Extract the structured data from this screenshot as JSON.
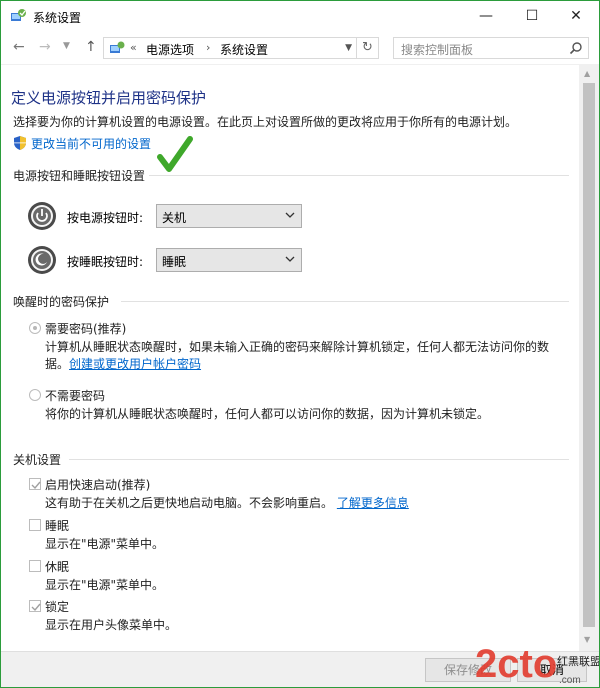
{
  "window": {
    "title": "系统设置",
    "min_glyph": "—",
    "max_glyph": "☐",
    "close_glyph": "✕"
  },
  "nav": {
    "back_glyph": "←",
    "forward_glyph": "→",
    "up_glyph": "↑",
    "breadcrumb_prefix": "«",
    "breadcrumb": [
      "电源选项",
      "系统设置"
    ],
    "breadcrumb_sep": "›",
    "search_placeholder": "搜索控制面板"
  },
  "page": {
    "title": "定义电源按钮并启用密码保护",
    "description": "选择要为你的计算机设置的电源设置。在此页上对设置所做的更改将应用于你所有的电源计划。",
    "change_link": "更改当前不可用的设置"
  },
  "power_buttons": {
    "heading": "电源按钮和睡眠按钮设置",
    "rows": [
      {
        "label": "按电源按钮时:",
        "value": "关机"
      },
      {
        "label": "按睡眠按钮时:",
        "value": "睡眠"
      }
    ]
  },
  "wake_password": {
    "heading": "唤醒时的密码保护",
    "options": [
      {
        "label": "需要密码(推荐)",
        "selected": true,
        "desc_line1": "计算机从睡眠状态唤醒时，如果未输入正确的密码来解除计算机锁定，任何人都无法访问你的数",
        "desc_line2_prefix": "据。",
        "desc_link": "创建或更改用户帐户密码"
      },
      {
        "label": "不需要密码",
        "selected": false,
        "desc_line1": "将你的计算机从睡眠状态唤醒时，任何人都可以访问你的数据，因为计算机未锁定。"
      }
    ]
  },
  "shutdown": {
    "heading": "关机设置",
    "items": [
      {
        "label": "启用快速启动(推荐)",
        "checked": true,
        "desc": "这有助于在关机之后更快地启动电脑。不会影响重启。",
        "link": "了解更多信息"
      },
      {
        "label": "睡眠",
        "checked": false,
        "desc": "显示在\"电源\"菜单中。"
      },
      {
        "label": "休眠",
        "checked": false,
        "desc": "显示在\"电源\"菜单中。"
      },
      {
        "label": "锁定",
        "checked": true,
        "desc": "显示在用户头像菜单中。"
      }
    ]
  },
  "footer": {
    "save_label": "保存修改",
    "cancel_label": "取消"
  },
  "watermark": {
    "brand": "2cto",
    "tag": "红黑联盟",
    "sub": ".com"
  },
  "colors": {
    "title_blue": "#1e3287",
    "link_blue": "#0066cc",
    "frame_green": "#2b9c3b",
    "check_green": "#3fa82b"
  }
}
